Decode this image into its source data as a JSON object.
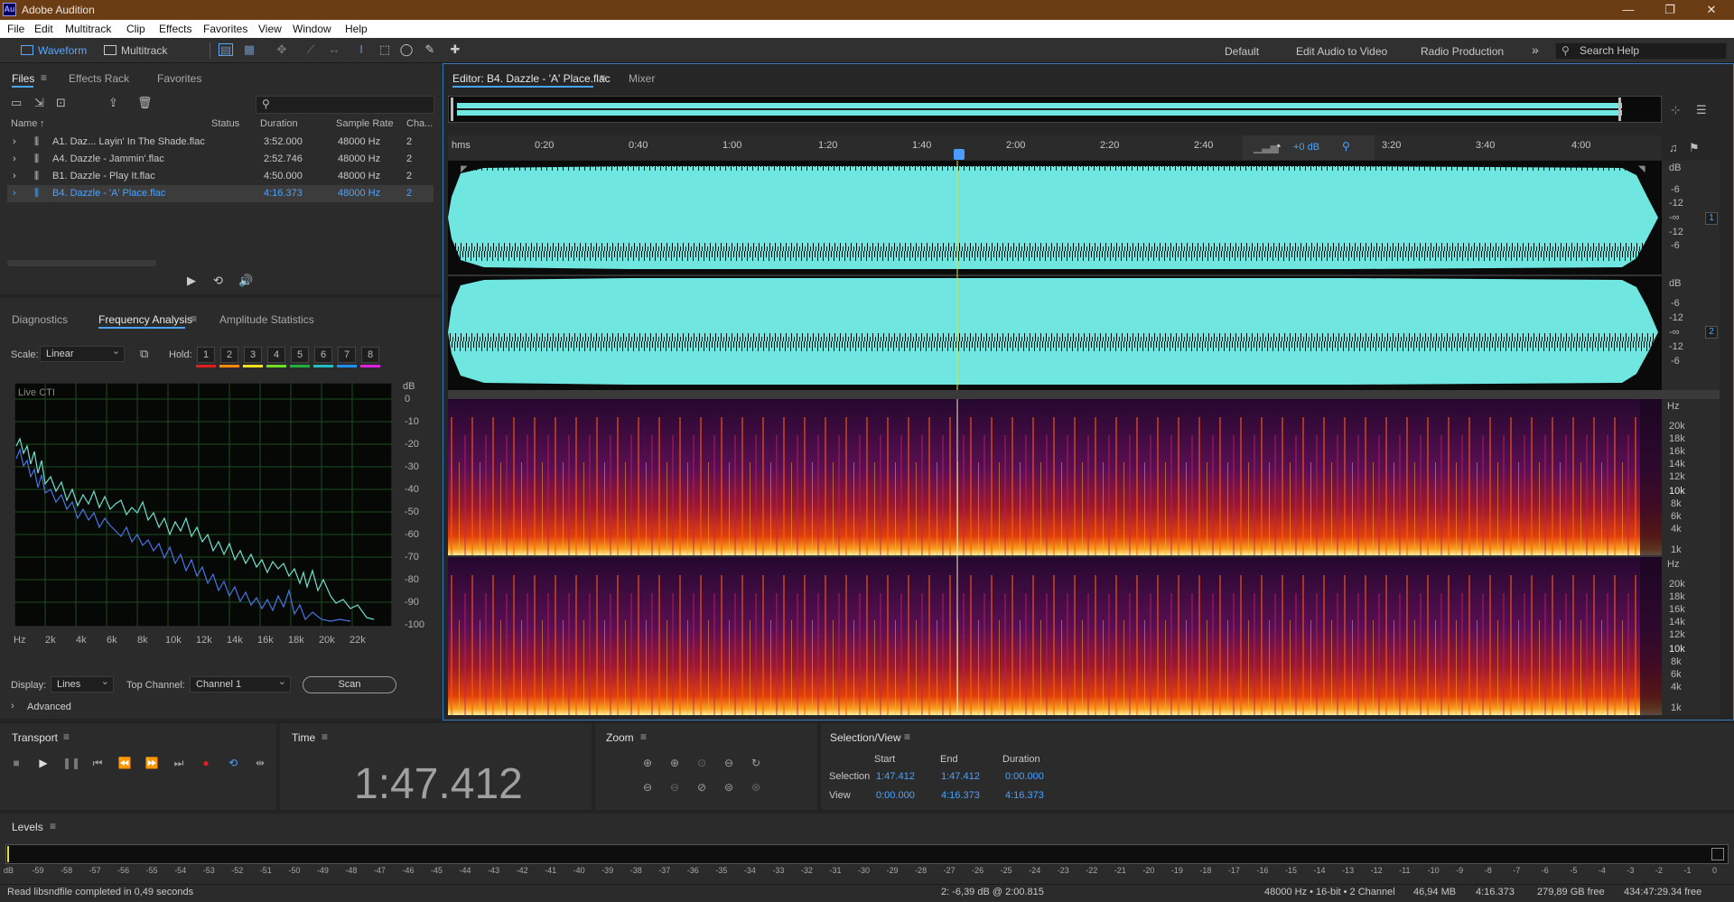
{
  "app": {
    "title": "Adobe Audition",
    "logo": "Au"
  },
  "menu": [
    "File",
    "Edit",
    "Multitrack",
    "Clip",
    "Effects",
    "Favorites",
    "View",
    "Window",
    "Help"
  ],
  "toolbar": {
    "waveform": "Waveform",
    "multitrack": "Multitrack"
  },
  "workspaces": [
    "Default",
    "Edit Audio to Video",
    "Radio Production"
  ],
  "search": {
    "placeholder": "Search Help"
  },
  "files_panel": {
    "tabs": [
      "Files",
      "Effects Rack",
      "Favorites"
    ],
    "columns": [
      "Name",
      "Status",
      "Duration",
      "Sample Rate",
      "Cha..."
    ],
    "rows": [
      {
        "name": "A1. Daz... Layin' In The Shade.flac",
        "status": "",
        "duration": "3:52.000",
        "rate": "48000 Hz",
        "ch": "2",
        "selected": false
      },
      {
        "name": "A4. Dazzle - Jammin'.flac",
        "status": "",
        "duration": "2:52.746",
        "rate": "48000 Hz",
        "ch": "2",
        "selected": false
      },
      {
        "name": "B1. Dazzle - Play It.flac",
        "status": "",
        "duration": "4:50.000",
        "rate": "48000 Hz",
        "ch": "2",
        "selected": false
      },
      {
        "name": "B4. Dazzle - 'A' Place.flac",
        "status": "",
        "duration": "4:16.373",
        "rate": "48000 Hz",
        "ch": "2",
        "selected": true
      }
    ]
  },
  "analysis": {
    "tabs": [
      "Diagnostics",
      "Frequency Analysis",
      "Amplitude Statistics"
    ],
    "scale_label": "Scale:",
    "scale_value": "Linear",
    "hold_label": "Hold:",
    "hold_buttons": [
      "1",
      "2",
      "3",
      "4",
      "5",
      "6",
      "7",
      "8"
    ],
    "hold_colors": [
      "#e02020",
      "#ff8a00",
      "#f0e020",
      "#70e020",
      "#20b040",
      "#20c0c0",
      "#2090f0",
      "#e020e0"
    ],
    "graph_label": "Live CTI",
    "db_unit": "dB",
    "db_ticks": [
      "0",
      "-10",
      "-20",
      "-30",
      "-40",
      "-50",
      "-60",
      "-70",
      "-80",
      "-90",
      "-100"
    ],
    "hz_ticks": [
      "Hz",
      "2k",
      "4k",
      "6k",
      "8k",
      "10k",
      "12k",
      "14k",
      "16k",
      "18k",
      "20k",
      "22k"
    ],
    "display_label": "Display:",
    "display_value": "Lines",
    "top_channel_label": "Top Channel:",
    "top_channel_value": "Channel 1",
    "scan": "Scan",
    "advanced": "Advanced"
  },
  "editor": {
    "tab": "Editor: B4. Dazzle - 'A' Place.flac",
    "mixer": "Mixer",
    "ruler": [
      "hms",
      "0:20",
      "0:40",
      "1:00",
      "1:20",
      "1:40",
      "2:00",
      "2:20",
      "2:40",
      "3:20",
      "3:40",
      "4:00"
    ],
    "hud_gain": "+0 dB",
    "db_unit": "dB",
    "ch1_scale": [
      "-6",
      "-12",
      "-∞",
      "-12",
      "-6"
    ],
    "ch2_scale": [
      "-6",
      "-12",
      "-∞",
      "-12",
      "-6"
    ],
    "ch_numbers": [
      "1",
      "2"
    ],
    "hz_unit": "Hz",
    "spec_scale": [
      "20k",
      "18k",
      "16k",
      "14k",
      "12k",
      "10k",
      "8k",
      "6k",
      "4k",
      "1k"
    ]
  },
  "transport": {
    "title": "Transport"
  },
  "time": {
    "title": "Time",
    "value": "1:47.412"
  },
  "zoom": {
    "title": "Zoom"
  },
  "selection": {
    "title": "Selection/View",
    "headers": [
      "Start",
      "End",
      "Duration"
    ],
    "rows": [
      {
        "label": "Selection",
        "start": "1:47.412",
        "end": "1:47.412",
        "duration": "0:00.000"
      },
      {
        "label": "View",
        "start": "0:00.000",
        "end": "4:16.373",
        "duration": "4:16.373"
      }
    ]
  },
  "levels": {
    "title": "Levels",
    "scale": [
      "dB",
      "-59",
      "-58",
      "-57",
      "-56",
      "-55",
      "-54",
      "-53",
      "-52",
      "-51",
      "-50",
      "-49",
      "-48",
      "-47",
      "-46",
      "-45",
      "-44",
      "-43",
      "-42",
      "-41",
      "-40",
      "-39",
      "-38",
      "-37",
      "-36",
      "-35",
      "-34",
      "-33",
      "-32",
      "-31",
      "-30",
      "-29",
      "-28",
      "-27",
      "-26",
      "-25",
      "-24",
      "-23",
      "-22",
      "-21",
      "-20",
      "-19",
      "-18",
      "-17",
      "-16",
      "-15",
      "-14",
      "-13",
      "-12",
      "-11",
      "-10",
      "-9",
      "-8",
      "-7",
      "-6",
      "-5",
      "-4",
      "-3",
      "-2",
      "-1",
      "0"
    ]
  },
  "status": {
    "message": "Read libsndfile completed in 0,49 seconds",
    "cursor": "2: -6,39 dB @ 2:00.815",
    "format": "48000 Hz • 16-bit • 2 Channel",
    "size": "46,94 MB",
    "duration": "4:16.373",
    "free": "279,89 GB free",
    "free_time": "434:47:29.34 free"
  }
}
